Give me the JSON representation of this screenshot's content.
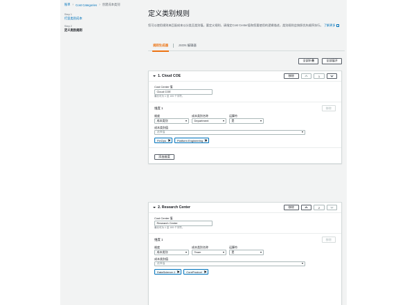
{
  "breadcrumb": {
    "root": "账单",
    "parent": "Cost Categories",
    "current": "创建成本类别"
  },
  "steps": [
    {
      "num": "Step 1",
      "title": "打造类别成本"
    },
    {
      "num": "Step 2",
      "title": "定义类别规则"
    }
  ],
  "page": {
    "title": "定义类别规则",
    "description": "您可以使用规则来匹配成本以分类至类别值。要定义规则，请指定Cost Center值和您要使用的逻辑描述，类别规则会按照优先顺序执行。",
    "learn_more": "了解更多"
  },
  "mode_tabs": [
    {
      "label": "规则生成器",
      "active": true
    },
    {
      "label": "JSON 编辑器",
      "active": false
    }
  ],
  "global_actions": {
    "collapse_all": "全部折叠",
    "expand_all": "全部展开"
  },
  "rules": [
    {
      "title": "1. Cloud COE",
      "remove_label": "移除",
      "order": "1",
      "value_label": "Cost Center 值",
      "value": "Cloud COE",
      "hint": "最长可为 1 至 100 个字符。",
      "dimension_title": "维度 1",
      "dimension_remove": "移除",
      "col_dimension": "维度",
      "col_key": "成本类别名称",
      "col_operator": "运算符",
      "dimension_value": "成本类别",
      "key_value": "Department",
      "operator_value": "是",
      "values_label": "成本类别值",
      "values_placeholder": "选择值",
      "tokens": [
        "FinOps",
        "Platform Engineering"
      ],
      "add_dimension": "添加维度"
    },
    {
      "title": "2. Research Center",
      "remove_label": "移除",
      "order": "2",
      "value_label": "Cost Center 值",
      "value": "Research Center",
      "hint": "最长可为 1 至 100 个字符。",
      "dimension_title": "维度 1",
      "dimension_remove": "移除",
      "col_dimension": "维度",
      "col_key": "成本类别名称",
      "col_operator": "运算符",
      "dimension_value": "成本类别",
      "key_value": "Team",
      "operator_value": "是",
      "values_label": "成本类别值",
      "values_placeholder": "选择值",
      "tokens": [
        "DataScience-1",
        "CoreProduct"
      ]
    }
  ],
  "colors": {
    "accent": "#ec7211",
    "link": "#0073bb",
    "token_border": "#0073bb",
    "token_bg": "#f1faff",
    "app_bg": "#f2f3f3"
  }
}
